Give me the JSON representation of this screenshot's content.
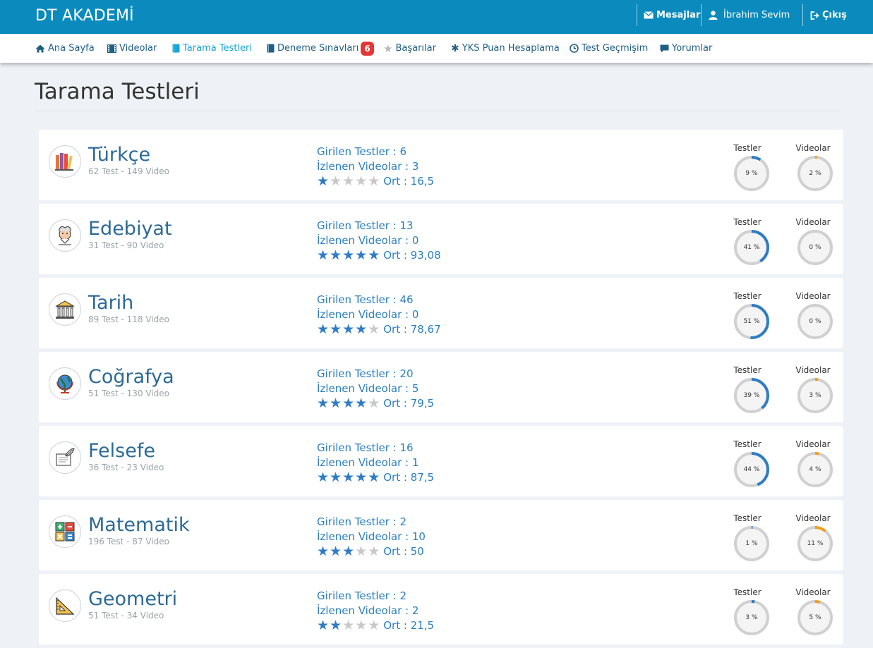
{
  "app": {
    "brand": "DT AKADEMİ"
  },
  "topbar": {
    "messages_label": "Mesajlar",
    "user_name": "İbrahim Sevim",
    "logout_label": "Çıkış"
  },
  "nav": {
    "items": [
      {
        "label": "Ana Sayfa",
        "icon": "home-icon"
      },
      {
        "label": "Videolar",
        "icon": "film-icon"
      },
      {
        "label": "Tarama Testleri",
        "icon": "book-icon",
        "active": true
      },
      {
        "label": "Deneme Sınavları",
        "icon": "book-icon",
        "badge": "6"
      },
      {
        "label": "Başarılar",
        "icon": "star-icon"
      },
      {
        "label": "YKS Puan Hesaplama",
        "icon": "asterisk-icon"
      },
      {
        "label": "Test Geçmişim",
        "icon": "clock-icon"
      },
      {
        "label": "Yorumlar",
        "icon": "comment-icon"
      }
    ]
  },
  "page": {
    "title": "Tarama Testleri"
  },
  "colors": {
    "accent": "#0a8abd",
    "tests_gauge": "#2f7cc3",
    "videos_gauge": "#f0a020",
    "badge": "#e33737"
  },
  "labels": {
    "tests_gauge": "Testler",
    "videos_gauge": "Videolar"
  },
  "subjects": [
    {
      "name": "Türkçe",
      "meta": "62 Test - 149 Video",
      "icon": "books-icon",
      "tests_entered": "Girilen Testler : 6",
      "videos_watched": "İzlenen Videolar : 3",
      "rating": 1,
      "average": "Ort : 16,5",
      "tests_pct": 9,
      "tests_pct_label": "9 %",
      "videos_pct": 2,
      "videos_pct_label": "2 %"
    },
    {
      "name": "Edebiyat",
      "meta": "31 Test - 90 Video",
      "icon": "poet-icon",
      "tests_entered": "Girilen Testler : 13",
      "videos_watched": "İzlenen Videolar : 0",
      "rating": 5,
      "average": "Ort : 93,08",
      "tests_pct": 41,
      "tests_pct_label": "41 %",
      "videos_pct": 0,
      "videos_pct_label": "0 %"
    },
    {
      "name": "Tarih",
      "meta": "89 Test - 118 Video",
      "icon": "temple-icon",
      "tests_entered": "Girilen Testler : 46",
      "videos_watched": "İzlenen Videolar : 0",
      "rating": 4,
      "average": "Ort : 78,67",
      "tests_pct": 51,
      "tests_pct_label": "51 %",
      "videos_pct": 0,
      "videos_pct_label": "0 %"
    },
    {
      "name": "Coğrafya",
      "meta": "51 Test - 130 Video",
      "icon": "globe-icon",
      "tests_entered": "Girilen Testler : 20",
      "videos_watched": "İzlenen Videolar : 5",
      "rating": 4,
      "average": "Ort : 79,5",
      "tests_pct": 39,
      "tests_pct_label": "39 %",
      "videos_pct": 3,
      "videos_pct_label": "3 %"
    },
    {
      "name": "Felsefe",
      "meta": "36 Test - 23 Video",
      "icon": "quill-icon",
      "tests_entered": "Girilen Testler : 16",
      "videos_watched": "İzlenen Videolar : 1",
      "rating": 5,
      "average": "Ort : 87,5",
      "tests_pct": 44,
      "tests_pct_label": "44 %",
      "videos_pct": 4,
      "videos_pct_label": "4 %"
    },
    {
      "name": "Matematik",
      "meta": "196 Test - 87 Video",
      "icon": "calculator-icon",
      "tests_entered": "Girilen Testler : 2",
      "videos_watched": "İzlenen Videolar : 10",
      "rating": 3,
      "average": "Ort : 50",
      "tests_pct": 1,
      "tests_pct_label": "1 %",
      "videos_pct": 11,
      "videos_pct_label": "11 %"
    },
    {
      "name": "Geometri",
      "meta": "51 Test - 34 Video",
      "icon": "set-square-icon",
      "tests_entered": "Girilen Testler : 2",
      "videos_watched": "İzlenen Videolar : 2",
      "rating": 2,
      "average": "Ort : 21,5",
      "tests_pct": 3,
      "tests_pct_label": "3 %",
      "videos_pct": 5,
      "videos_pct_label": "5 %"
    }
  ]
}
